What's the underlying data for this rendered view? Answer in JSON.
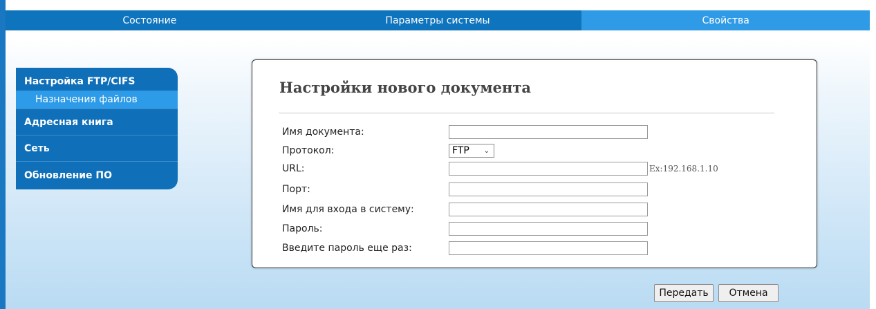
{
  "topnav": {
    "tabs": [
      {
        "label": "Состояние"
      },
      {
        "label": "Параметры системы"
      },
      {
        "label": "Свойства",
        "active": true
      }
    ]
  },
  "sidebar": {
    "items": [
      {
        "label": "Настройка FTP/CIFS"
      },
      {
        "label": "Назначения файлов",
        "sub": true,
        "selected": true
      },
      {
        "label": "Адресная книга"
      },
      {
        "label": "Сеть"
      },
      {
        "label": "Обновление ПО"
      }
    ]
  },
  "form": {
    "title": "Настройки нового документа",
    "fields": {
      "doc_name": {
        "label": "Имя документа:",
        "value": ""
      },
      "protocol": {
        "label": "Протокол:",
        "value": "FTP"
      },
      "url": {
        "label": "URL:",
        "value": "",
        "hint": "Ex:192.168.1.10"
      },
      "port": {
        "label": "Порт:",
        "value": ""
      },
      "login": {
        "label": "Имя для входа в систему:",
        "value": ""
      },
      "password": {
        "label": "Пароль:",
        "value": ""
      },
      "password_confirm": {
        "label": "Введите пароль еще раз:",
        "value": ""
      }
    }
  },
  "buttons": {
    "submit": "Передать",
    "cancel": "Отмена"
  },
  "colors": {
    "nav_bg": "#0e74bd",
    "nav_active": "#2f9ae6",
    "sidebar_bg": "#0f6fb8",
    "sidebar_selected": "#2e9be8"
  }
}
